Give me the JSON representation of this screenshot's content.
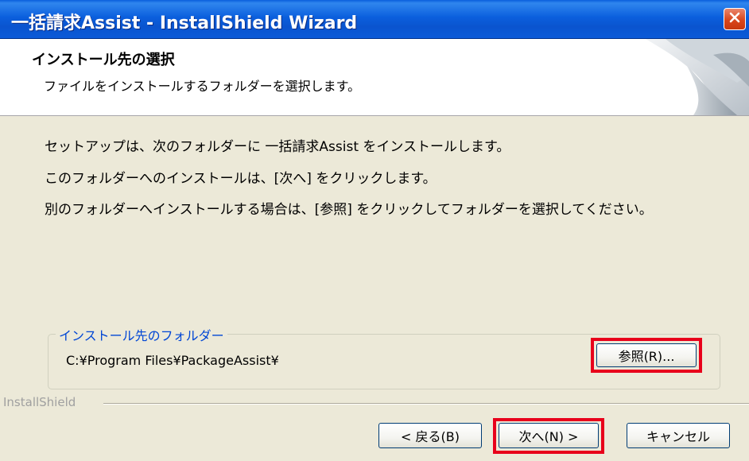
{
  "window": {
    "title": "一括請求Assist - InstallShield Wizard"
  },
  "header": {
    "title": "インストール先の選択",
    "subtitle": "ファイルをインストールするフォルダーを選択します。"
  },
  "body": {
    "line1": "セットアップは、次のフォルダーに 一括請求Assist をインストールします。",
    "line2": "このフォルダーへのインストールは、[次へ] をクリックします。",
    "line3": "別のフォルダーへインストールする場合は、[参照] をクリックしてフォルダーを選択してください。"
  },
  "destination": {
    "legend": "インストール先のフォルダー",
    "path": "C:¥Program Files¥PackageAssist¥",
    "browse_label": "参照(R)..."
  },
  "footer": {
    "brand": "InstallShield",
    "back_label": "< 戻る(B)",
    "next_label": "次へ(N) >",
    "cancel_label": "キャンセル"
  },
  "colors": {
    "titlebar": "#0a5edc",
    "dialog_bg": "#ece9d8",
    "legend_text": "#0046d5",
    "highlight_border": "#e8001b",
    "close_button": "#d9461b"
  },
  "icons": {
    "close": "close-icon",
    "header_art": "wizard-header-graphic"
  }
}
